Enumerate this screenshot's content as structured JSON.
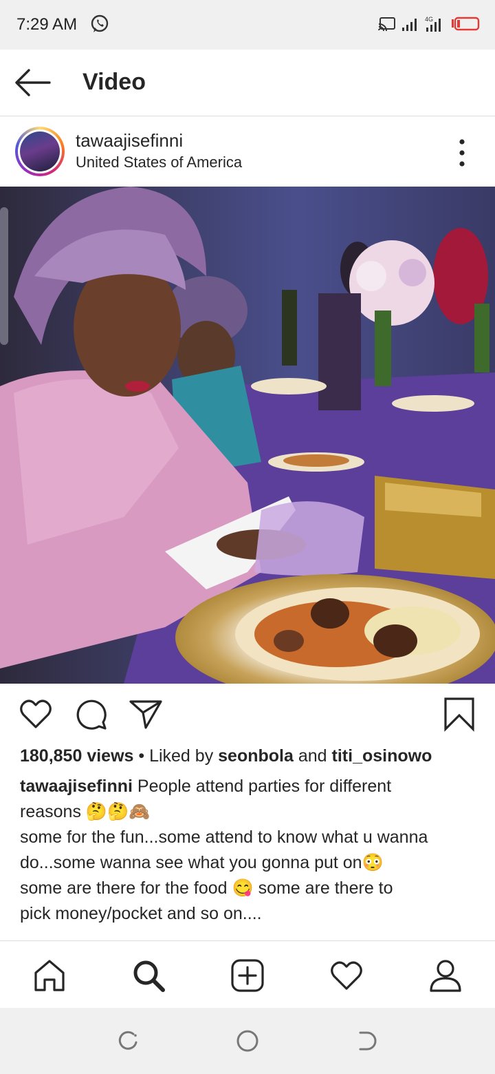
{
  "status_bar": {
    "time": "7:29 AM",
    "icons": [
      "whatsapp-icon",
      "cast-icon",
      "signal-icon",
      "signal-4g-icon",
      "battery-low-icon"
    ],
    "battery_color": "#e53935"
  },
  "header": {
    "title": "Video",
    "back_icon": "back-arrow-icon"
  },
  "post": {
    "username": "tawaajisefinni",
    "location": "United States of America",
    "more_icon": "more-vertical-icon",
    "actions": [
      "heart-icon",
      "comment-icon",
      "share-icon",
      "bookmark-icon"
    ],
    "views": "180,850 views",
    "liked_by_prefix": "• Liked by",
    "liked_by_user1": "seonbola",
    "liked_by_and": "and",
    "liked_by_user2": "titi_osinowo",
    "caption_user": "tawaajisefinni",
    "caption_line1": "People attend parties for different",
    "caption_line2": "reasons 🤔🤔🙈",
    "caption_line3": "some for the fun...some attend to know what u wanna",
    "caption_line4": "do...some wanna see what you gonna put on😳",
    "caption_line5": "some are there for the food 😋 some are there to",
    "caption_line6": "pick money/pocket and so on...."
  },
  "bottom_nav": [
    "home-icon",
    "search-icon",
    "add-post-icon",
    "activity-heart-icon",
    "profile-icon"
  ],
  "system_nav": [
    "recents-icon",
    "home-circle-icon",
    "back-icon"
  ]
}
